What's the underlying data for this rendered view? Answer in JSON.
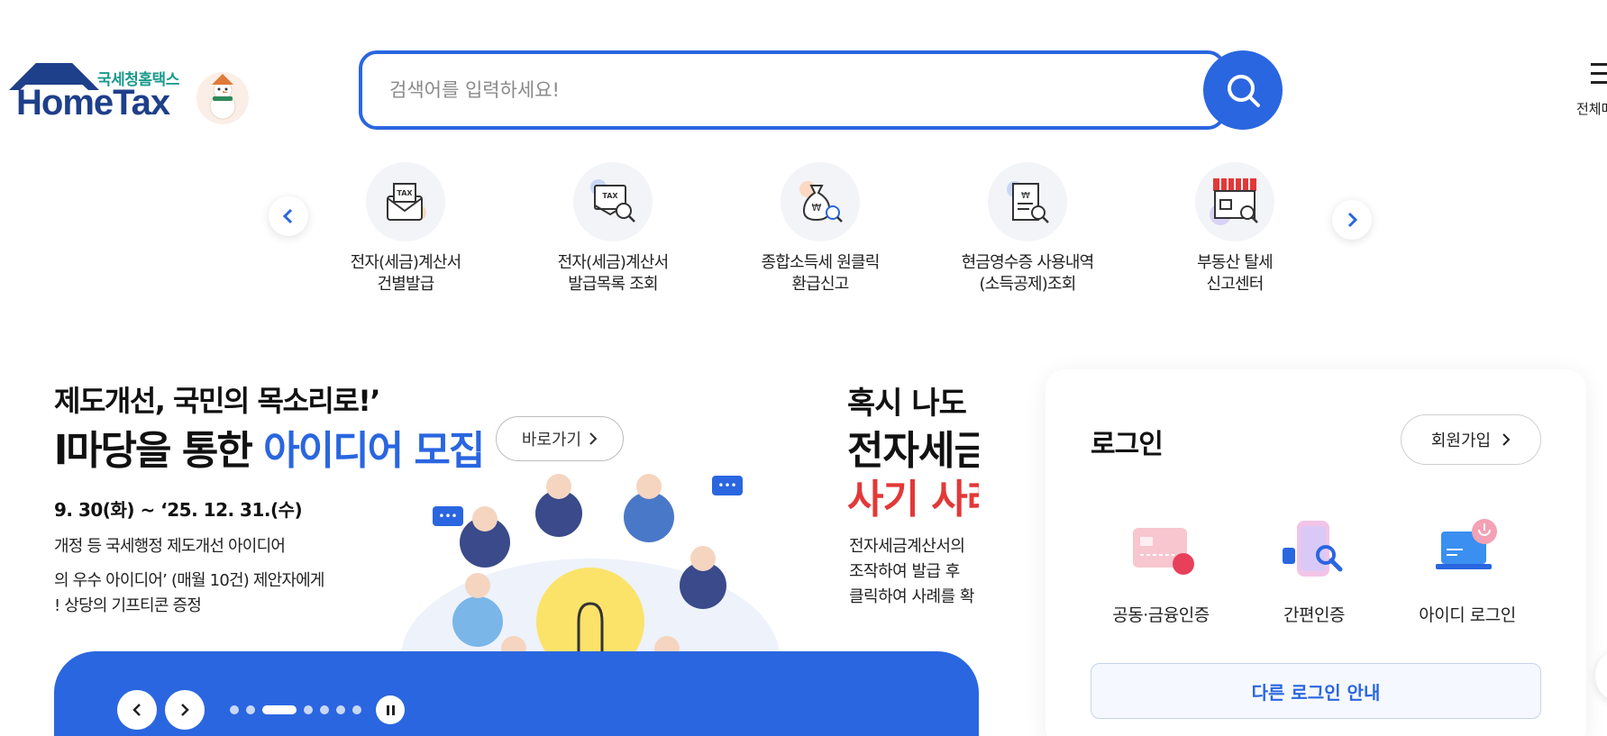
{
  "header": {
    "logo_sub": "국세청홈택스",
    "logo_main": "HomeTax",
    "search_placeholder": "검색어를 입력하세요!",
    "all_menu_label": "전체메"
  },
  "quick_menu": {
    "items": [
      {
        "label": "전자(세금)계산서\n건별발급",
        "icon": "tax-envelope-icon"
      },
      {
        "label": "전자(세금)계산서\n발급목록 조회",
        "icon": "tax-search-icon"
      },
      {
        "label": "종합소득세 원클릭\n환급신고",
        "icon": "money-bag-icon"
      },
      {
        "label": "현금영수증 사용내역\n(소득공제)조회",
        "icon": "receipt-search-icon"
      },
      {
        "label": "부동산 탈세\n신고센터",
        "icon": "store-search-icon"
      }
    ]
  },
  "banner": {
    "slide1": {
      "title_line1": "제도개선, 국민의 목소리로!’",
      "title_line2_prefix": "l마당을 통한 ",
      "title_line2_highlight": "아이디어 모집",
      "go_label": "바로가기",
      "date": "9. 30(화) ~ ‘25. 12. 31.(수)",
      "line1": "개정 등 국세행정 제도개선 아이디어",
      "line2": "의 우수 아이디어’ (매월 10건) 제안자에게",
      "line3": "! 상당의 기프티콘 증정"
    },
    "slide2": {
      "title_line1": "혹시 나도",
      "title_line2": "전자세금",
      "title_line3": "사기 사례",
      "line1": "전자세금계산서의",
      "line2": "조작하여 발급 후",
      "line3": "클릭하여 사례를 확"
    },
    "dots_count": 7,
    "active_dot": 2
  },
  "login": {
    "title": "로그인",
    "join_label": "회원가입",
    "options": [
      {
        "label": "공동·금융인증",
        "icon": "certificate-card-icon"
      },
      {
        "label": "간편인증",
        "icon": "simple-auth-phone-icon"
      },
      {
        "label": "아이디 로그인",
        "icon": "id-login-laptop-icon"
      }
    ],
    "other_login_label": "다른 로그인 안내"
  },
  "colors": {
    "primary": "#2a66e0",
    "accent_red": "#e33838",
    "logo_teal": "#1a9a8c",
    "logo_navy": "#1e3f8a"
  }
}
